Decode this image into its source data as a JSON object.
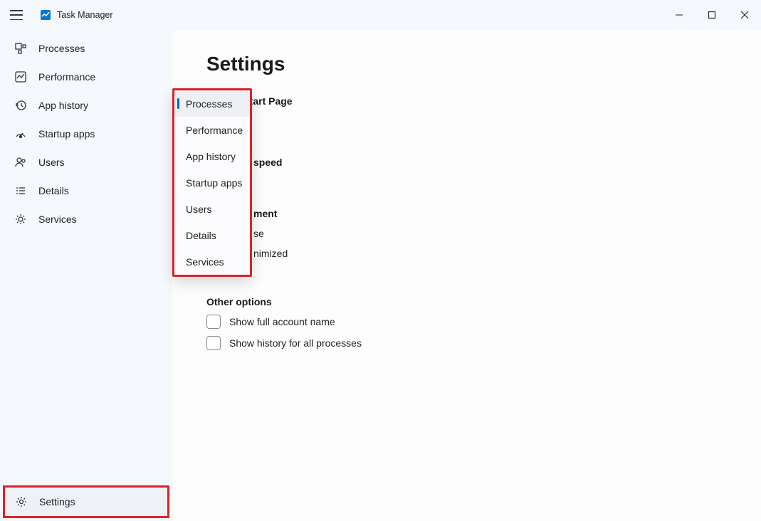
{
  "app": {
    "title": "Task Manager"
  },
  "sidebar": {
    "items": [
      {
        "label": "Processes"
      },
      {
        "label": "Performance"
      },
      {
        "label": "App history"
      },
      {
        "label": "Startup apps"
      },
      {
        "label": "Users"
      },
      {
        "label": "Details"
      },
      {
        "label": "Services"
      }
    ],
    "settings_label": "Settings"
  },
  "content": {
    "title": "Settings",
    "default_start_page_label": "Default Start Page",
    "speed_suffix": "speed",
    "management_suffix": "ment",
    "hidden_row1_suffix": "se",
    "hidden_row2_suffix": "nimized",
    "other_options_label": "Other options",
    "checkbox1": "Show full account name",
    "checkbox2": "Show history for all processes"
  },
  "flyout": {
    "items": [
      "Processes",
      "Performance",
      "App history",
      "Startup apps",
      "Users",
      "Details",
      "Services"
    ],
    "selected_index": 0
  }
}
